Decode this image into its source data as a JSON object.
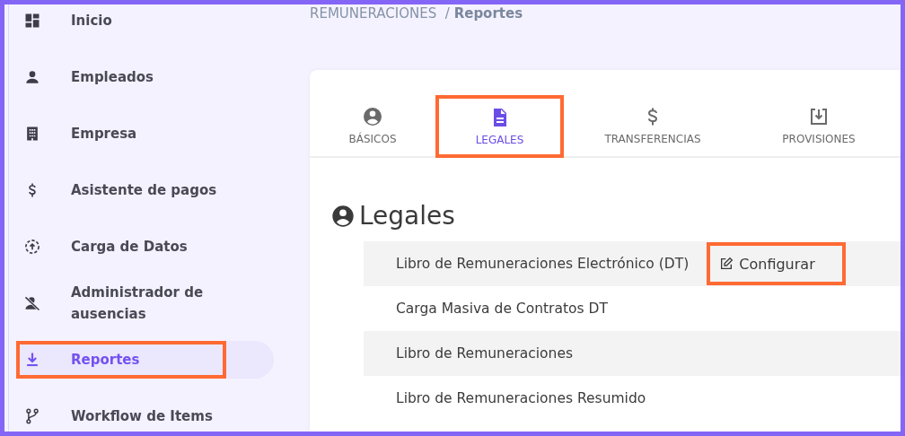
{
  "sidebar": {
    "items": [
      {
        "label": "Inicio",
        "selected": false,
        "highlighted": false
      },
      {
        "label": "Empleados",
        "selected": false,
        "highlighted": false
      },
      {
        "label": "Empresa",
        "selected": false,
        "highlighted": false
      },
      {
        "label": "Asistente de pagos",
        "selected": false,
        "highlighted": false
      },
      {
        "label": "Carga de Datos",
        "selected": false,
        "highlighted": false
      },
      {
        "label": "Administrador de ausencias",
        "selected": false,
        "highlighted": false
      },
      {
        "label": "Reportes",
        "selected": true,
        "highlighted": true
      },
      {
        "label": "Workflow de Items",
        "selected": false,
        "highlighted": false
      }
    ]
  },
  "breadcrumb": {
    "section": "REMUNERACIONES",
    "separator": "/",
    "current": "Reportes"
  },
  "tabs": [
    {
      "label": "BÁSICOS",
      "selected": false,
      "highlighted": false
    },
    {
      "label": "LEGALES",
      "selected": true,
      "highlighted": true
    },
    {
      "label": "TRANSFERENCIAS",
      "selected": false,
      "highlighted": false
    },
    {
      "label": "PROVISIONES",
      "selected": false,
      "highlighted": false
    }
  ],
  "section": {
    "title": "Legales",
    "reports": [
      {
        "label": "Libro de Remuneraciones Electrónico (DT)",
        "action": {
          "label": "Configurar",
          "highlighted": true
        }
      },
      {
        "label": "Carga Masiva de Contratos DT"
      },
      {
        "label": "Libro de Remuneraciones"
      },
      {
        "label": "Libro de Remuneraciones Resumido"
      }
    ]
  }
}
